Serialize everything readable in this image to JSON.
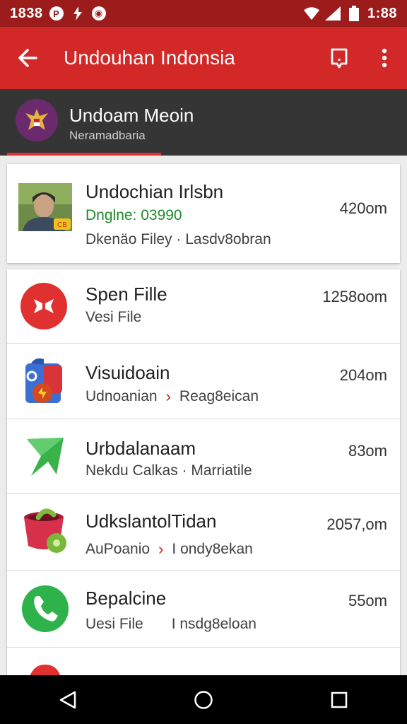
{
  "status_bar": {
    "time_left": "1838",
    "time_right": "1:88",
    "notif_icons": [
      "p-icon",
      "bolt-icon",
      "camera-icon"
    ]
  },
  "app_bar": {
    "title": "Undouhan Indonsia"
  },
  "header": {
    "title": "Undoam Meoin",
    "subtitle": "Neramadbaria"
  },
  "list": {
    "items": [
      {
        "title": "Undochian Irlsbn",
        "sub_a": "Dnglne: 03990",
        "sub_b": "Dkenäo Filey · Lasdv8obran",
        "size": "420om",
        "icon": "avatar-photo"
      },
      {
        "title": "Spen Fille",
        "sub_a": "Vesi File",
        "size": "1258oom",
        "icon": "red-circle-app"
      },
      {
        "title": "Visuidoain",
        "sub_a": "Udnoanian",
        "sub_b": "Reag8eican",
        "size": "204om",
        "icon": "box-app"
      },
      {
        "title": "Urbdalanaam",
        "sub_a": "Nekdu Calkas · Marriatile",
        "size": "83om",
        "icon": "green-arrow-app"
      },
      {
        "title": "UdkslantolTidan",
        "sub_a": "AuPoanio",
        "sub_b": "I ondy8ekan",
        "size": "2057,om",
        "icon": "red-pot-app"
      },
      {
        "title": "Bepalcine",
        "sub_a": "Uesi File",
        "sub_b": "I nsdg8eloan",
        "size": "55om",
        "icon": "phone-app"
      }
    ]
  },
  "colors": {
    "app_bar": "#d32828",
    "status_bar": "#9c1c1c",
    "header_band": "#353535",
    "accent_green": "#1f8a2a"
  }
}
